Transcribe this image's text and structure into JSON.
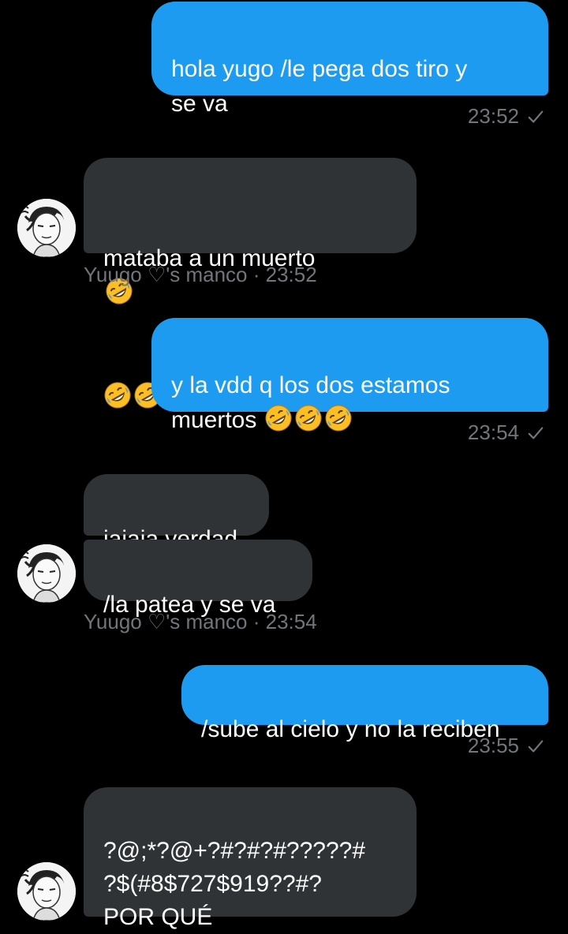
{
  "colors": {
    "background": "#000000",
    "outgoing_bubble": "#1d9bf0",
    "incoming_bubble": "#2f3336",
    "meta_text": "#71767b"
  },
  "messages": [
    {
      "text": "hola yugo /le pega dos tiro y\nse va",
      "time": "23:52",
      "direction": "out"
    },
    {
      "text": "mataba a un muerto",
      "emoji_icon": "rolling-on-floor-laughing-emoji",
      "direction": "in"
    },
    {
      "sender_line": "Yuugo ♡'s manco · 23:52"
    },
    {
      "text": "y la vdd q los dos estamos\nmuertos",
      "time": "23:54",
      "direction": "out"
    },
    {
      "text": "jajaja verdad",
      "direction": "in"
    },
    {
      "text": "/la patea y se va",
      "direction": "in"
    },
    {
      "sender_line": "Yuugo ♡'s manco · 23:54"
    },
    {
      "text": "/sube al cielo y no la reciben",
      "time": "23:55",
      "direction": "out"
    },
    {
      "text": "?@;*?@+?#?#?#?????#\n?$(#8$727$919??#?\nPOR QUÉ",
      "direction": "in"
    }
  ],
  "status_icon": "sent-check-icon",
  "avatar_icon": "anime-avatar-icon"
}
